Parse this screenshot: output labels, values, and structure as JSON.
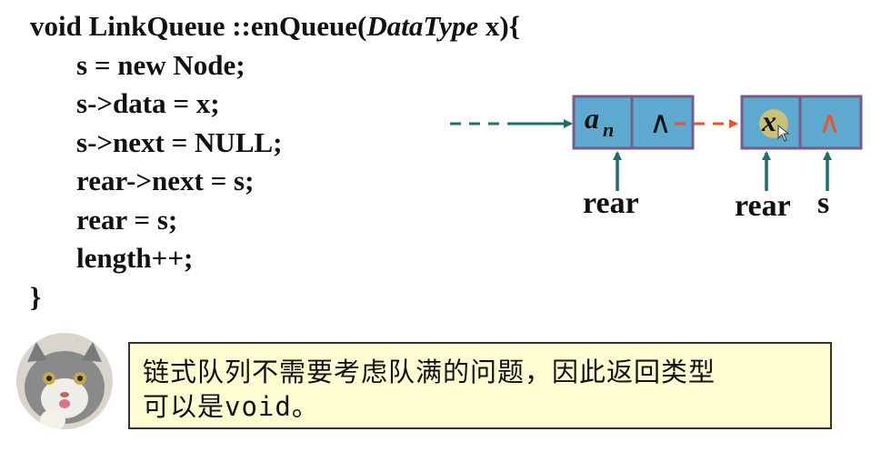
{
  "code": {
    "signature_prefix": "void LinkQueue ::enQueue(",
    "signature_type": "DataType",
    "signature_suffix": " x){",
    "lines": [
      "s = new Node;",
      "s->data = x;",
      "s->next = NULL;",
      "rear->next = s;",
      "rear = s;",
      "length++;"
    ],
    "closing": "}"
  },
  "diagram": {
    "node1_data": "a",
    "node1_data_sub": "n",
    "node1_next": "∧",
    "node2_data": "x",
    "node2_next": "∧",
    "label_rear_old": "rear",
    "label_rear_new": "rear",
    "label_s": "s",
    "colors": {
      "node_fill": "#5ea9cf",
      "node_border": "#7a5a8c",
      "arrow": "#1f6e6e",
      "new_link": "#e8562a",
      "highlight": "#c9c07a"
    }
  },
  "note": {
    "line1": "链式队列不需要考虑队满的问题，因此返回类型",
    "line2": "可以是void。"
  },
  "avatar": {
    "icon": "cat-avatar-icon"
  }
}
